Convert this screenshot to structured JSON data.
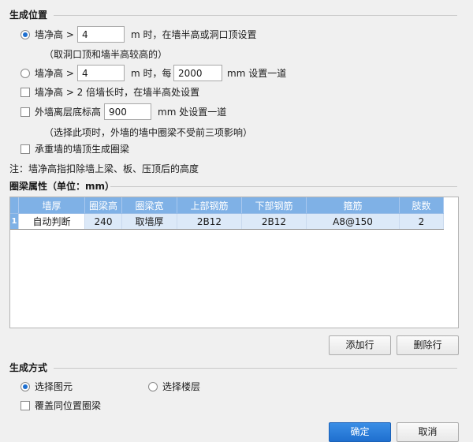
{
  "position_section": {
    "title": "生成位置",
    "opt1_label": "墙净高 >",
    "opt1_value": "4",
    "opt1_text": "m 时，在墙半高或洞口顶设置",
    "opt1_note": "（取洞口顶和墙半高较高的）",
    "opt2_label": "墙净高 >",
    "opt2_value": "4",
    "opt2_mid": "m 时，每",
    "opt2_spacing": "2000",
    "opt2_end": "mm 设置一道",
    "check1_label": "墙净高 > 2 倍墙长时，在墙半高处设置",
    "check2_label": "外墙离层底标高",
    "check2_value": "900",
    "check2_end": "mm 处设置一道",
    "check2_note": "（选择此项时，外墙的墙中圈梁不受前三项影响）",
    "check3_label": "承重墙的墙顶生成圈梁",
    "note": "注：墙净高指扣除墙上梁、板、压顶后的高度"
  },
  "props_section": {
    "title": "圈梁属性（单位：mm）",
    "columns": [
      "墙厚",
      "圈梁高",
      "圈梁宽",
      "上部钢筋",
      "下部钢筋",
      "箍筋",
      "肢数"
    ],
    "rows": [
      {
        "index": "1",
        "cells": [
          "自动判断",
          "240",
          "取墙厚",
          "2B12",
          "2B12",
          "A8@150",
          "2"
        ]
      }
    ],
    "add_row": "添加行",
    "delete_row": "删除行"
  },
  "method_section": {
    "title": "生成方式",
    "radio1": "选择图元",
    "radio2": "选择楼层",
    "overwrite": "覆盖同位置圈梁"
  },
  "footer": {
    "ok": "确定",
    "cancel": "取消"
  },
  "colors": {
    "header_blue": "#7fb1e6",
    "row_highlight": "#dce9f8",
    "primary": "#1f6fcf"
  }
}
